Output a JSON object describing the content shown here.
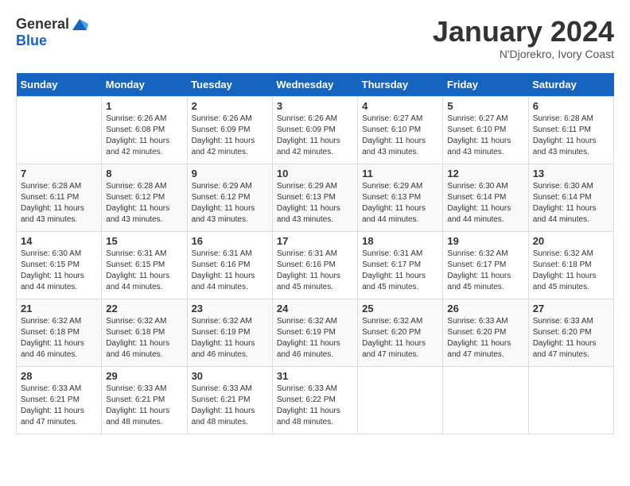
{
  "header": {
    "logo_general": "General",
    "logo_blue": "Blue",
    "month_title": "January 2024",
    "subtitle": "N'Djorekro, Ivory Coast"
  },
  "calendar": {
    "days_of_week": [
      "Sunday",
      "Monday",
      "Tuesday",
      "Wednesday",
      "Thursday",
      "Friday",
      "Saturday"
    ],
    "weeks": [
      [
        {
          "day": "",
          "info": ""
        },
        {
          "day": "1",
          "info": "Sunrise: 6:26 AM\nSunset: 6:08 PM\nDaylight: 11 hours and 42 minutes."
        },
        {
          "day": "2",
          "info": "Sunrise: 6:26 AM\nSunset: 6:09 PM\nDaylight: 11 hours and 42 minutes."
        },
        {
          "day": "3",
          "info": "Sunrise: 6:26 AM\nSunset: 6:09 PM\nDaylight: 11 hours and 42 minutes."
        },
        {
          "day": "4",
          "info": "Sunrise: 6:27 AM\nSunset: 6:10 PM\nDaylight: 11 hours and 43 minutes."
        },
        {
          "day": "5",
          "info": "Sunrise: 6:27 AM\nSunset: 6:10 PM\nDaylight: 11 hours and 43 minutes."
        },
        {
          "day": "6",
          "info": "Sunrise: 6:28 AM\nSunset: 6:11 PM\nDaylight: 11 hours and 43 minutes."
        }
      ],
      [
        {
          "day": "7",
          "info": "Sunrise: 6:28 AM\nSunset: 6:11 PM\nDaylight: 11 hours and 43 minutes."
        },
        {
          "day": "8",
          "info": "Sunrise: 6:28 AM\nSunset: 6:12 PM\nDaylight: 11 hours and 43 minutes."
        },
        {
          "day": "9",
          "info": "Sunrise: 6:29 AM\nSunset: 6:12 PM\nDaylight: 11 hours and 43 minutes."
        },
        {
          "day": "10",
          "info": "Sunrise: 6:29 AM\nSunset: 6:13 PM\nDaylight: 11 hours and 43 minutes."
        },
        {
          "day": "11",
          "info": "Sunrise: 6:29 AM\nSunset: 6:13 PM\nDaylight: 11 hours and 44 minutes."
        },
        {
          "day": "12",
          "info": "Sunrise: 6:30 AM\nSunset: 6:14 PM\nDaylight: 11 hours and 44 minutes."
        },
        {
          "day": "13",
          "info": "Sunrise: 6:30 AM\nSunset: 6:14 PM\nDaylight: 11 hours and 44 minutes."
        }
      ],
      [
        {
          "day": "14",
          "info": "Sunrise: 6:30 AM\nSunset: 6:15 PM\nDaylight: 11 hours and 44 minutes."
        },
        {
          "day": "15",
          "info": "Sunrise: 6:31 AM\nSunset: 6:15 PM\nDaylight: 11 hours and 44 minutes."
        },
        {
          "day": "16",
          "info": "Sunrise: 6:31 AM\nSunset: 6:16 PM\nDaylight: 11 hours and 44 minutes."
        },
        {
          "day": "17",
          "info": "Sunrise: 6:31 AM\nSunset: 6:16 PM\nDaylight: 11 hours and 45 minutes."
        },
        {
          "day": "18",
          "info": "Sunrise: 6:31 AM\nSunset: 6:17 PM\nDaylight: 11 hours and 45 minutes."
        },
        {
          "day": "19",
          "info": "Sunrise: 6:32 AM\nSunset: 6:17 PM\nDaylight: 11 hours and 45 minutes."
        },
        {
          "day": "20",
          "info": "Sunrise: 6:32 AM\nSunset: 6:18 PM\nDaylight: 11 hours and 45 minutes."
        }
      ],
      [
        {
          "day": "21",
          "info": "Sunrise: 6:32 AM\nSunset: 6:18 PM\nDaylight: 11 hours and 46 minutes."
        },
        {
          "day": "22",
          "info": "Sunrise: 6:32 AM\nSunset: 6:18 PM\nDaylight: 11 hours and 46 minutes."
        },
        {
          "day": "23",
          "info": "Sunrise: 6:32 AM\nSunset: 6:19 PM\nDaylight: 11 hours and 46 minutes."
        },
        {
          "day": "24",
          "info": "Sunrise: 6:32 AM\nSunset: 6:19 PM\nDaylight: 11 hours and 46 minutes."
        },
        {
          "day": "25",
          "info": "Sunrise: 6:32 AM\nSunset: 6:20 PM\nDaylight: 11 hours and 47 minutes."
        },
        {
          "day": "26",
          "info": "Sunrise: 6:33 AM\nSunset: 6:20 PM\nDaylight: 11 hours and 47 minutes."
        },
        {
          "day": "27",
          "info": "Sunrise: 6:33 AM\nSunset: 6:20 PM\nDaylight: 11 hours and 47 minutes."
        }
      ],
      [
        {
          "day": "28",
          "info": "Sunrise: 6:33 AM\nSunset: 6:21 PM\nDaylight: 11 hours and 47 minutes."
        },
        {
          "day": "29",
          "info": "Sunrise: 6:33 AM\nSunset: 6:21 PM\nDaylight: 11 hours and 48 minutes."
        },
        {
          "day": "30",
          "info": "Sunrise: 6:33 AM\nSunset: 6:21 PM\nDaylight: 11 hours and 48 minutes."
        },
        {
          "day": "31",
          "info": "Sunrise: 6:33 AM\nSunset: 6:22 PM\nDaylight: 11 hours and 48 minutes."
        },
        {
          "day": "",
          "info": ""
        },
        {
          "day": "",
          "info": ""
        },
        {
          "day": "",
          "info": ""
        }
      ]
    ]
  }
}
